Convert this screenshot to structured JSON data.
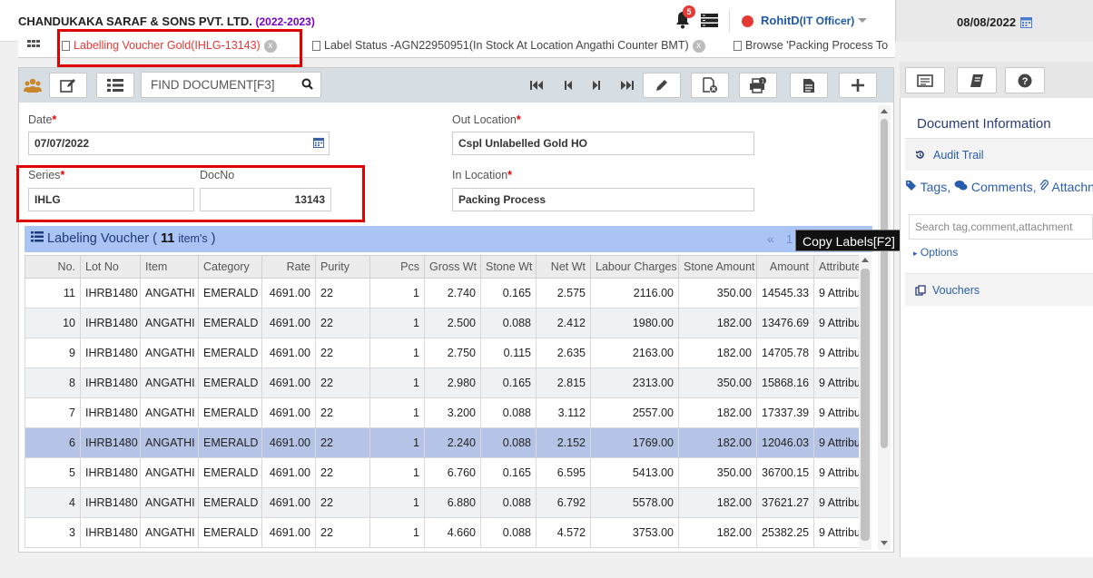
{
  "header": {
    "company": "CHANDUKAKA SARAF & SONS PVT. LTD.",
    "year": "(2022-2023)",
    "notification_count": "5",
    "user": "RohitD",
    "role": "(IT Officer)",
    "date": "08/08/2022"
  },
  "tabs": [
    {
      "label": "Labelling Voucher Gold(IHLG-13143)"
    },
    {
      "label": "Label Status -AGN22950951(In Stock At Location Angathi Counter BMT)"
    },
    {
      "label": "Browse 'Packing Process To"
    }
  ],
  "toolbar": {
    "find_placeholder": "FIND DOCUMENT[F3]"
  },
  "form": {
    "date_label": "Date",
    "date_value": "07/07/2022",
    "out_location_label": "Out Location",
    "out_location_value": "Cspl Unlabelled Gold HO",
    "series_label": "Series",
    "series_value": "IHLG",
    "docno_label": "DocNo",
    "docno_value": "13143",
    "in_location_label": "In Location",
    "in_location_value": "Packing Process"
  },
  "grid": {
    "title": "Labeling Voucher (",
    "count": "11",
    "items_label": "item's",
    "close": ")",
    "tooltip": "Copy Labels[F2]",
    "pager_prev": "«",
    "pager_page": "1",
    "columns": [
      "No.",
      "Lot No",
      "Item",
      "Category",
      "Rate",
      "Purity",
      "Pcs",
      "Gross Wt",
      "Stone Wt",
      "Net Wt",
      "Labour Charges",
      "Stone Amount",
      "Amount",
      "Attribute"
    ],
    "rows": [
      [
        "11",
        "IHRB1480",
        "ANGATHI",
        "EMERALD",
        "4691.00",
        "22",
        "1",
        "2.740",
        "0.165",
        "2.575",
        "2116.00",
        "350.00",
        "14545.33",
        "9 Attribut"
      ],
      [
        "10",
        "IHRB1480",
        "ANGATHI",
        "EMERALD",
        "4691.00",
        "22",
        "1",
        "2.500",
        "0.088",
        "2.412",
        "1980.00",
        "182.00",
        "13476.69",
        "9 Attribut"
      ],
      [
        "9",
        "IHRB1480",
        "ANGATHI",
        "EMERALD",
        "4691.00",
        "22",
        "1",
        "2.750",
        "0.115",
        "2.635",
        "2163.00",
        "182.00",
        "14705.78",
        "9 Attribut"
      ],
      [
        "8",
        "IHRB1480",
        "ANGATHI",
        "EMERALD",
        "4691.00",
        "22",
        "1",
        "2.980",
        "0.165",
        "2.815",
        "2313.00",
        "350.00",
        "15868.16",
        "9 Attribut"
      ],
      [
        "7",
        "IHRB1480",
        "ANGATHI",
        "EMERALD",
        "4691.00",
        "22",
        "1",
        "3.200",
        "0.088",
        "3.112",
        "2557.00",
        "182.00",
        "17337.39",
        "9 Attribut"
      ],
      [
        "6",
        "IHRB1480",
        "ANGATHI",
        "EMERALD",
        "4691.00",
        "22",
        "1",
        "2.240",
        "0.088",
        "2.152",
        "1769.00",
        "182.00",
        "12046.03",
        "9 Attribut"
      ],
      [
        "5",
        "IHRB1480",
        "ANGATHI",
        "EMERALD",
        "4691.00",
        "22",
        "1",
        "6.760",
        "0.165",
        "6.595",
        "5413.00",
        "350.00",
        "36700.15",
        "9 Attribut"
      ],
      [
        "4",
        "IHRB1480",
        "ANGATHI",
        "EMERALD",
        "4691.00",
        "22",
        "1",
        "6.880",
        "0.088",
        "6.792",
        "5578.00",
        "182.00",
        "37621.27",
        "9 Attribut"
      ],
      [
        "3",
        "IHRB1480",
        "ANGATHI",
        "EMERALD",
        "4691.00",
        "22",
        "1",
        "4.660",
        "0.088",
        "4.572",
        "3753.00",
        "182.00",
        "25382.25",
        "9 Attribut"
      ]
    ],
    "selected_row": 5
  },
  "sidebar": {
    "title": "Document Information",
    "audit": "Audit Trail",
    "tags": "Tags,",
    "comments": "Comments,",
    "attach": "Attachn",
    "search_placeholder": "Search tag,comment,attachment",
    "options": "Options",
    "vouchers": "Vouchers"
  },
  "colors": {
    "highlight": "#e00000",
    "grid_header": "#a9c4f5",
    "selected_row": "#b4c3e6",
    "accent": "#1f5aa6"
  }
}
